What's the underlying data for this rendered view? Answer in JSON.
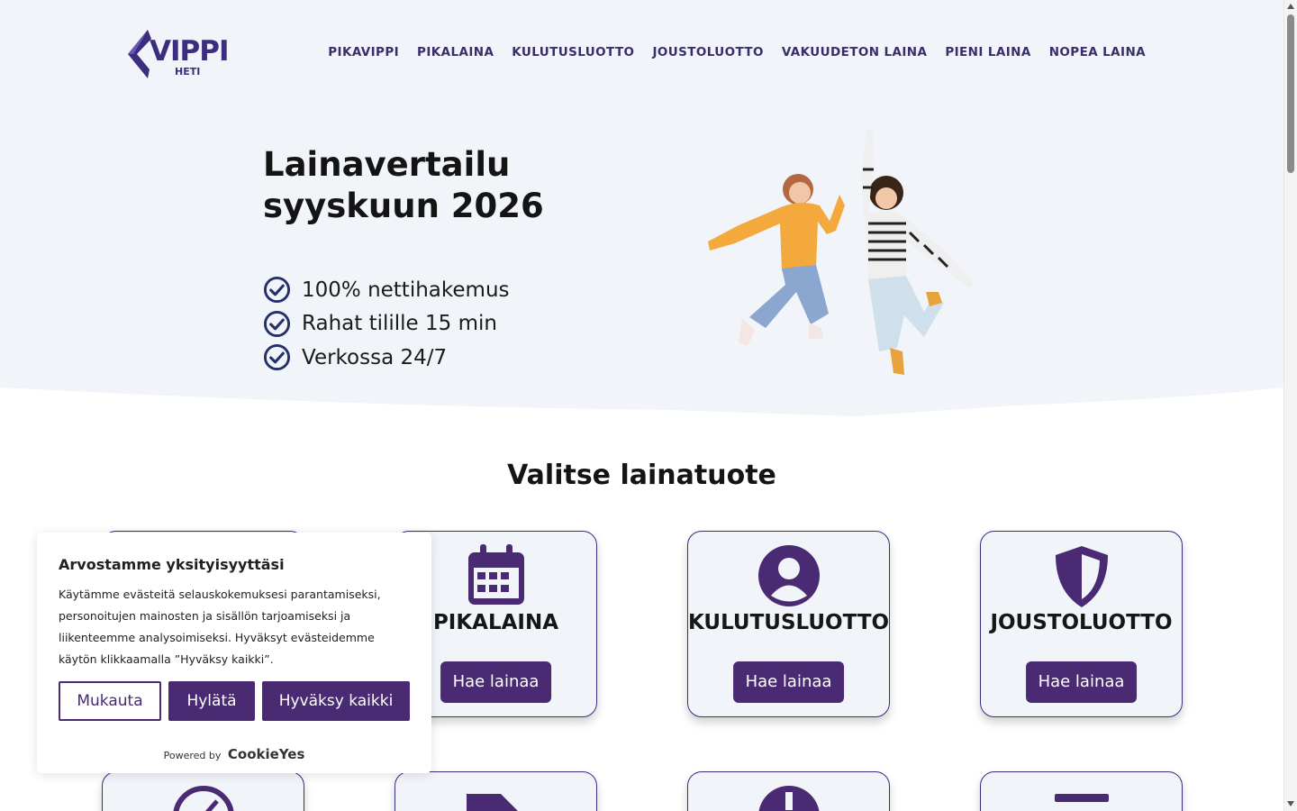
{
  "brand": {
    "logo_text": "VIPPI",
    "logo_sub": "HETI",
    "accent": "#4a2a72",
    "hero_bg": "#f1f4f9"
  },
  "nav": {
    "items": [
      "PIKAVIPPI",
      "PIKALAINA",
      "KULUTUSLUOTTO",
      "JOUSTOLUOTTO",
      "VAKUUDETON LAINA",
      "PIENI LAINA",
      "NOPEA LAINA"
    ]
  },
  "hero": {
    "title_line1": "Lainavertailu",
    "title_line2": "syyskuun 2026",
    "bullets": [
      "100% nettihakemus",
      "Rahat tilille 15 min",
      "Verkossa 24/7"
    ],
    "image_icon": "jumping-women-photo"
  },
  "section": {
    "title": "Valitse lainatuote"
  },
  "cards": [
    {
      "title": "PIKALAINA",
      "icon": "calendar-icon",
      "button": "Hae lainaa"
    },
    {
      "title": "KULUTUSLUOTTO",
      "icon": "user-circle-icon",
      "button": "Hae lainaa"
    },
    {
      "title": "JOUSTOLUOTTO",
      "icon": "shield-icon",
      "button": "Hae lainaa"
    }
  ],
  "cookie": {
    "title": "Arvostamme yksityisyyttäsi",
    "text": "Käytämme evästeitä selauskokemuksesi parantamiseksi, personoitujen mainosten ja sisällön tarjoamiseksi ja liikenteemme analysoimiseksi. Hyväksyt evästeidemme käytön klikkaamalla ”Hyväksy kaikki”.",
    "customize": "Mukauta",
    "reject": "Hylätä",
    "accept": "Hyväksy kaikki",
    "powered_by": "Powered by",
    "powered_brand": "CookieYes"
  }
}
